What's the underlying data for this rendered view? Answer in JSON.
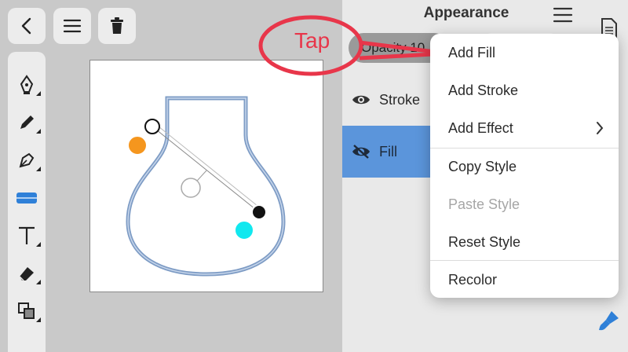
{
  "panel": {
    "title": "Appearance"
  },
  "panel_rows": [
    {
      "label": "Opacity 10"
    },
    {
      "label": "Stroke"
    },
    {
      "label": "Fill"
    }
  ],
  "menu": {
    "items": [
      {
        "label": "Add Fill"
      },
      {
        "label": "Add Stroke"
      },
      {
        "label": "Add Effect"
      },
      {
        "label": "Copy Style"
      },
      {
        "label": "Paste Style"
      },
      {
        "label": "Reset Style"
      },
      {
        "label": "Recolor"
      }
    ]
  },
  "annotation": {
    "text": "Tap"
  },
  "colors": {
    "accent": "#2f80d8",
    "fill_row": "#5b95db",
    "annotation": "#e8364a",
    "gradient_start": "#f5961e",
    "gradient_end": "#11e8ef",
    "shape_stroke": "#7e9cc5"
  },
  "icons": [
    "back-icon",
    "menu-icon",
    "trash-icon",
    "pen-icon",
    "pencil-icon",
    "nib-icon",
    "panel-tool-icon",
    "text-tool-icon",
    "eraser-icon",
    "transform-icon",
    "eye-icon",
    "eye-slash-icon",
    "chevron-right-icon",
    "document-icon",
    "brush-icon"
  ]
}
